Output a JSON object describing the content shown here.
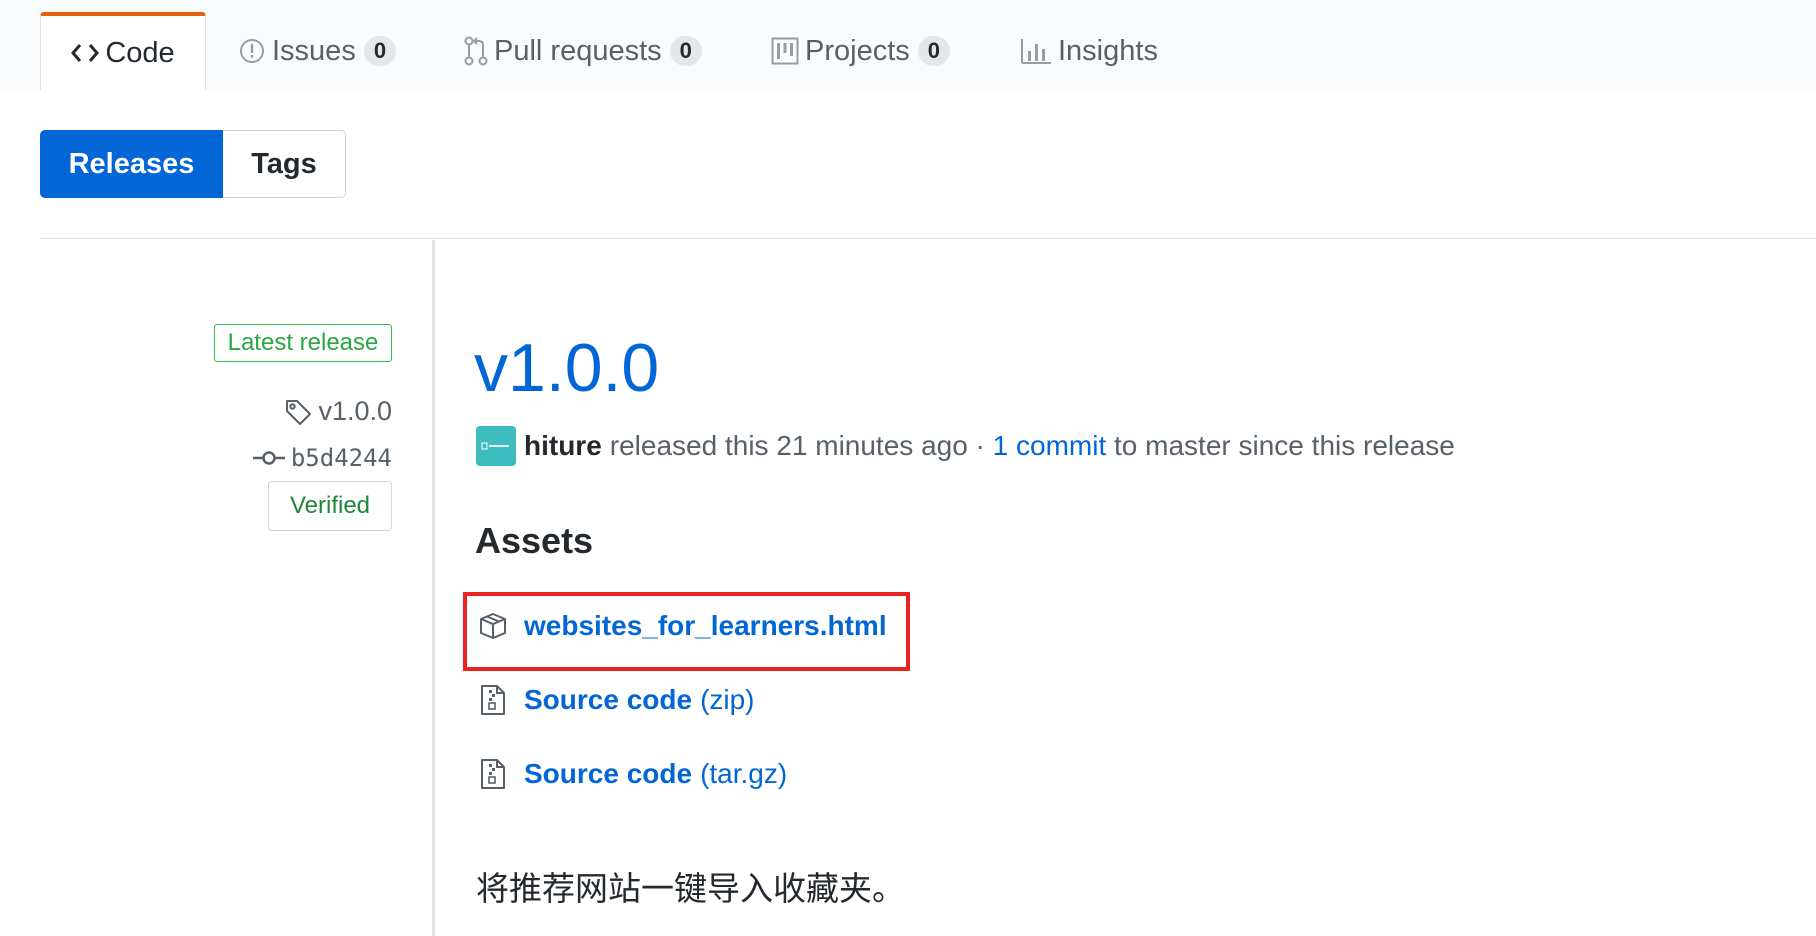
{
  "nav": {
    "tabs": [
      {
        "label": "Code",
        "icon": "code-icon",
        "selected": true
      },
      {
        "label": "Issues",
        "icon": "issue-opened-icon",
        "count": "0"
      },
      {
        "label": "Pull requests",
        "icon": "git-pull-request-icon",
        "count": "0"
      },
      {
        "label": "Projects",
        "icon": "project-icon",
        "count": "0"
      },
      {
        "label": "Insights",
        "icon": "graph-icon"
      }
    ]
  },
  "subnav": {
    "releases_label": "Releases",
    "tags_label": "Tags"
  },
  "sidebar": {
    "latest_label": "Latest release",
    "tag": "v1.0.0",
    "commit": "b5d4244",
    "verified_label": "Verified"
  },
  "release": {
    "title": "v1.0.0",
    "author": "hiture",
    "released_text": "released this 21 minutes ago ·",
    "commit_link": "1 commit",
    "since_text": "to master since this release",
    "assets_heading": "Assets",
    "assets": [
      {
        "name": "websites_for_learners.html",
        "type": "",
        "icon": "package-icon",
        "highlighted": true
      },
      {
        "name": "Source code",
        "type": "(zip)",
        "icon": "file-zip-icon"
      },
      {
        "name": "Source code",
        "type": "(tar.gz)",
        "icon": "file-zip-icon"
      }
    ],
    "description": "将推荐网站一键导入收藏夹。"
  },
  "colors": {
    "accent_blue": "#0366d6",
    "tab_highlight": "#e36209",
    "latest_green": "#28a745",
    "annotation_red": "#e9231f",
    "avatar_teal": "#3ebcbf"
  }
}
